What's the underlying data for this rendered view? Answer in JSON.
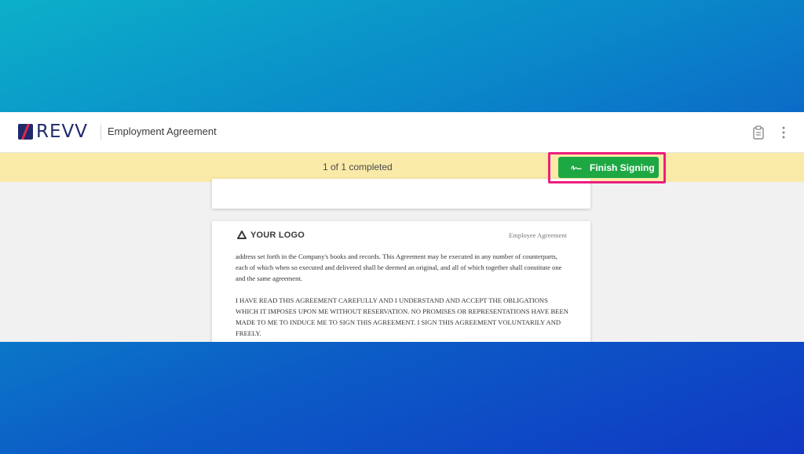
{
  "app": {
    "brand": "REVV",
    "document_title": "Employment Agreement",
    "icons": {
      "clipboard": "clipboard-icon",
      "more": "more-vertical-icon",
      "signature": "signature-icon",
      "logo": "logo-mark-icon"
    }
  },
  "banner": {
    "progress": "1 of 1 completed",
    "finish_label": "Finish Signing"
  },
  "document": {
    "logo_text": "YOUR LOGO",
    "header_label": "Employee Agreement",
    "paragraphs": [
      "address set forth in the Company's books and records. This Agreement may be executed in any number of counterparts, each of which when so executed and delivered shall be deemed an original, and all of which together shall constitute one and the same agreement.",
      "I HAVE READ THIS AGREEMENT CAREFULLY AND I UNDERSTAND AND ACCEPT THE OBLIGATIONS WHICH IT IMPOSES UPON ME WITHOUT RESERVATION. NO PROMISES OR REPRESENTATIONS HAVE BEEN MADE TO ME TO INDUCE ME TO SIGN THIS AGREEMENT. I SIGN THIS AGREEMENT VOLUNTARILY AND FREELY."
    ]
  },
  "colors": {
    "brand": "#1f2a6b",
    "accent": "#e2264d",
    "banner": "#faeaa8",
    "finish_button": "#1ea844",
    "highlight": "#ec1e7e"
  }
}
